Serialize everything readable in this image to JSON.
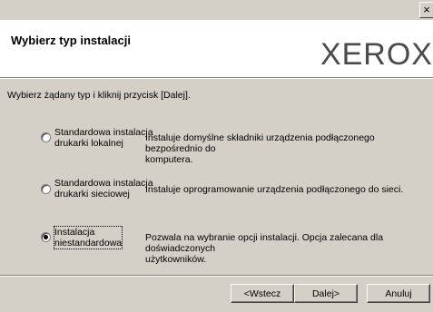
{
  "window": {
    "close_glyph": "×"
  },
  "header": {
    "title": "Wybierz typ instalacji",
    "logo": "XEROX"
  },
  "instruction": "Wybierz żądany typ i kliknij przycisk [Dalej].",
  "options": [
    {
      "label_lines": [
        "Standardowa instalacja",
        "drukarki lokalnej"
      ],
      "desc_lines": [
        "Instaluje domyślne składniki urządzenia podłączonego bezpośrednio do",
        "komputera."
      ],
      "selected": false
    },
    {
      "label_lines": [
        "Standardowa instalacja",
        "drukarki sieciowej"
      ],
      "desc_lines": [
        "Instaluje oprogramowanie urządzenia podłączonego do sieci."
      ],
      "selected": false
    },
    {
      "label_lines": [
        "Instalacja",
        "niestandardowa"
      ],
      "desc_lines": [
        "Pozwala na wybranie opcji instalacji. Opcja zalecana dla doświadczonych",
        "użytkowników."
      ],
      "selected": true
    }
  ],
  "buttons": {
    "back": "<Wstecz",
    "next": "Dalej>",
    "cancel": "Anuluj"
  }
}
